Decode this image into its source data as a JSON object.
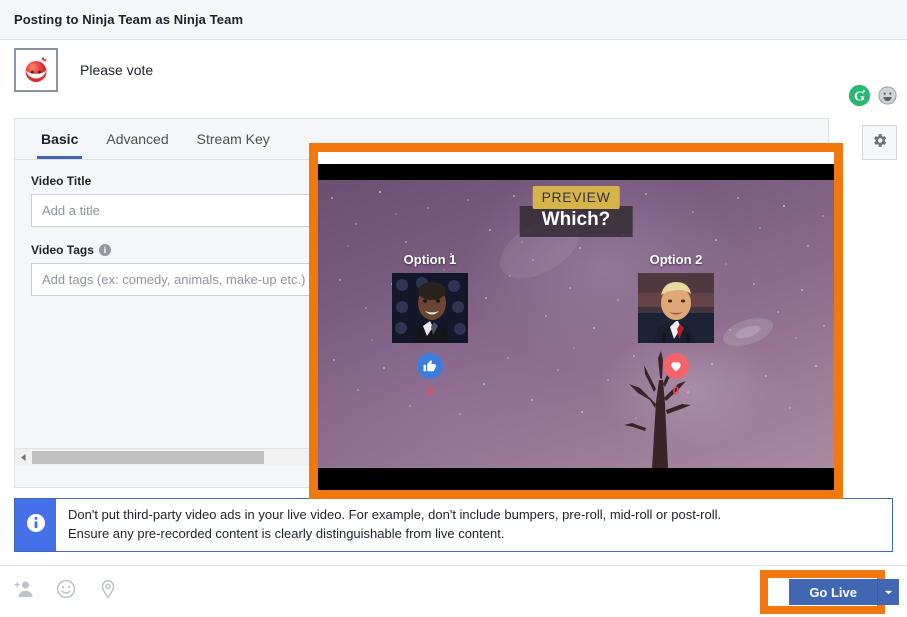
{
  "window": {
    "title": "Posting to Ninja Team as Ninja Team"
  },
  "composer": {
    "avatar_icon": "ninja-mask-avatar",
    "status_text": "Please vote",
    "refresh_icon": "green-g-refresh-icon",
    "emoji_icon": "smiley-icon"
  },
  "panel": {
    "tabs": [
      {
        "label": "Basic",
        "active": true
      },
      {
        "label": "Advanced",
        "active": false
      },
      {
        "label": "Stream Key",
        "active": false
      }
    ],
    "settings_icon": "gear-icon",
    "fields": {
      "video_title": {
        "label": "Video Title",
        "value": "",
        "placeholder": "Add a title"
      },
      "video_tags": {
        "label": "Video Tags",
        "info_icon": "info-icon",
        "value": "",
        "placeholder": "Add tags (ex: comedy, animals, make-up etc.)"
      }
    },
    "scrollbar": {
      "left_arrow_icon": "arrow-left-icon",
      "right_arrow_icon": "arrow-right-icon"
    }
  },
  "video_preview": {
    "highlight_color": "#f0780f",
    "badge": "PREVIEW",
    "title": "Which?",
    "badge_color": "#d6b44a",
    "options": [
      {
        "label": "Option 1",
        "photo_alt": "obama-photo",
        "reaction_icon": "thumbs-up-icon",
        "reaction_color": "#3b7ddd",
        "count": "0"
      },
      {
        "label": "Option 2",
        "photo_alt": "trump-photo",
        "reaction_icon": "heart-icon",
        "reaction_color": "#f3636b",
        "count": "0"
      }
    ],
    "count_color": "#f04a4a"
  },
  "notice": {
    "icon": "info-icon",
    "accent_color": "#4471e8",
    "line1": "Don't put third-party video ads in your live video. For example, don't include bumpers, pre-roll, mid-roll or post-roll.",
    "line2": "Ensure any pre-recorded content is clearly distinguishable from live content."
  },
  "footer": {
    "icons": [
      {
        "name": "tag-person-icon"
      },
      {
        "name": "smiley-icon"
      },
      {
        "name": "location-pin-icon"
      }
    ],
    "go_live_label": "Go Live",
    "go_live_color": "#4267b2",
    "caret_icon": "chevron-down-icon",
    "highlight_color": "#f0780f"
  }
}
